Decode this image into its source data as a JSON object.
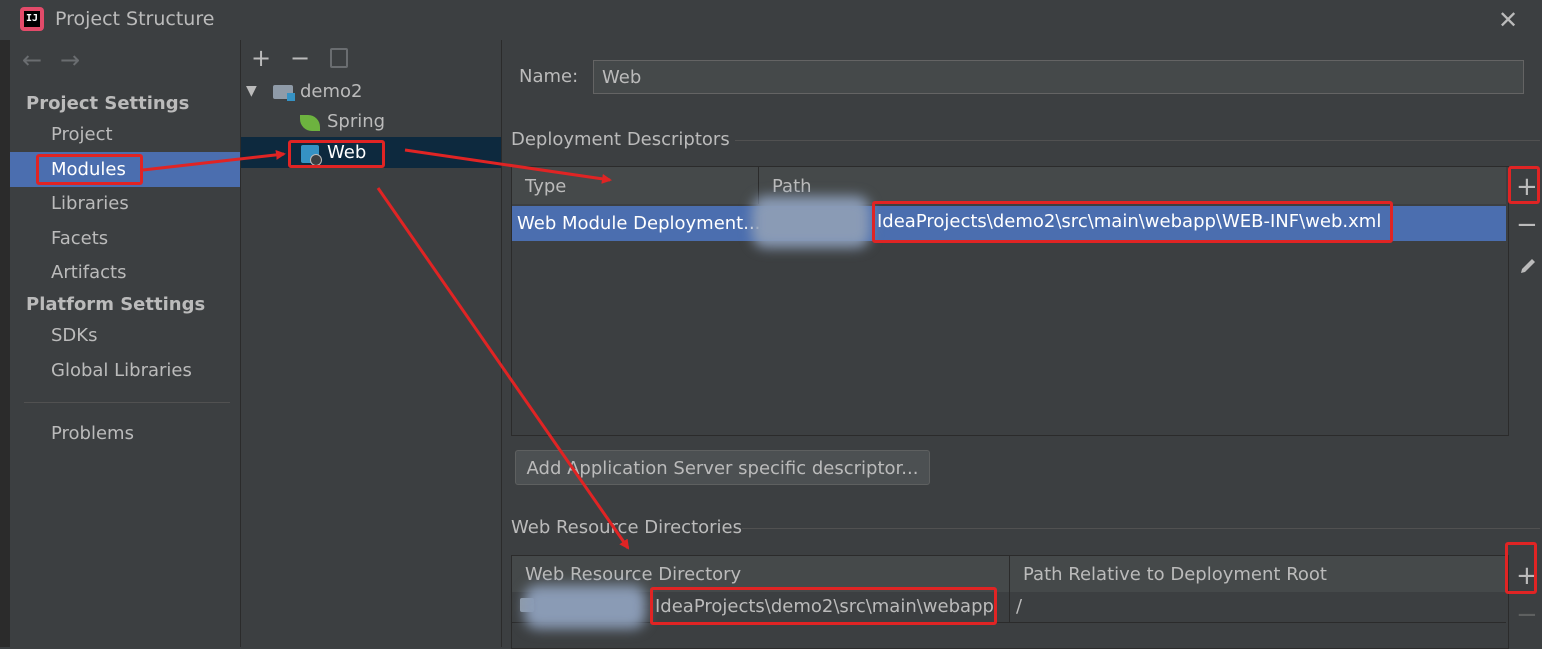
{
  "window": {
    "title": "Project Structure",
    "close_glyph": "✕",
    "app_icon": "intellij-idea-icon"
  },
  "nav": {
    "back_glyph": "←",
    "forward_glyph": "→"
  },
  "sidebar": {
    "project_settings_header": "Project Settings",
    "project_items": [
      "Project",
      "Modules",
      "Libraries",
      "Facets",
      "Artifacts"
    ],
    "platform_settings_header": "Platform Settings",
    "platform_items": [
      "SDKs",
      "Global Libraries"
    ],
    "problems": "Problems",
    "selected": "Modules"
  },
  "tree": {
    "toolbar": {
      "add": "+",
      "remove": "−",
      "copy_icon": "copy-icon"
    },
    "root": {
      "expand_glyph": "▼",
      "label": "demo2"
    },
    "children": [
      {
        "label": "Spring",
        "icon": "spring-leaf-icon"
      },
      {
        "label": "Web",
        "icon": "web-facet-icon",
        "selected": true
      }
    ]
  },
  "main": {
    "name_label": "Name:",
    "name_value": "Web",
    "deployment_descriptors": {
      "title": "Deployment Descriptors",
      "columns": [
        "Type",
        "Path"
      ],
      "rows": [
        {
          "type": "Web Module Deployment...",
          "path": "IdeaProjects\\demo2\\src\\main\\webapp\\WEB-INF\\web.xml"
        }
      ],
      "tools": {
        "add": "+",
        "remove": "−",
        "edit_icon": "pencil-icon"
      },
      "add_server_button": "Add Application Server specific descriptor..."
    },
    "web_resource_directories": {
      "title": "Web Resource Directories",
      "columns": [
        "Web Resource Directory",
        "Path Relative to Deployment Root"
      ],
      "rows": [
        {
          "directory": "IdeaProjects\\demo2\\src\\main\\webapp",
          "relative": "/"
        }
      ],
      "tools": {
        "add": "+",
        "remove": "−"
      }
    }
  },
  "colors": {
    "selection": "#4b6eaf",
    "tree_selection": "#0d293e",
    "annotation": "#e02424",
    "background": "#3c3f41"
  }
}
